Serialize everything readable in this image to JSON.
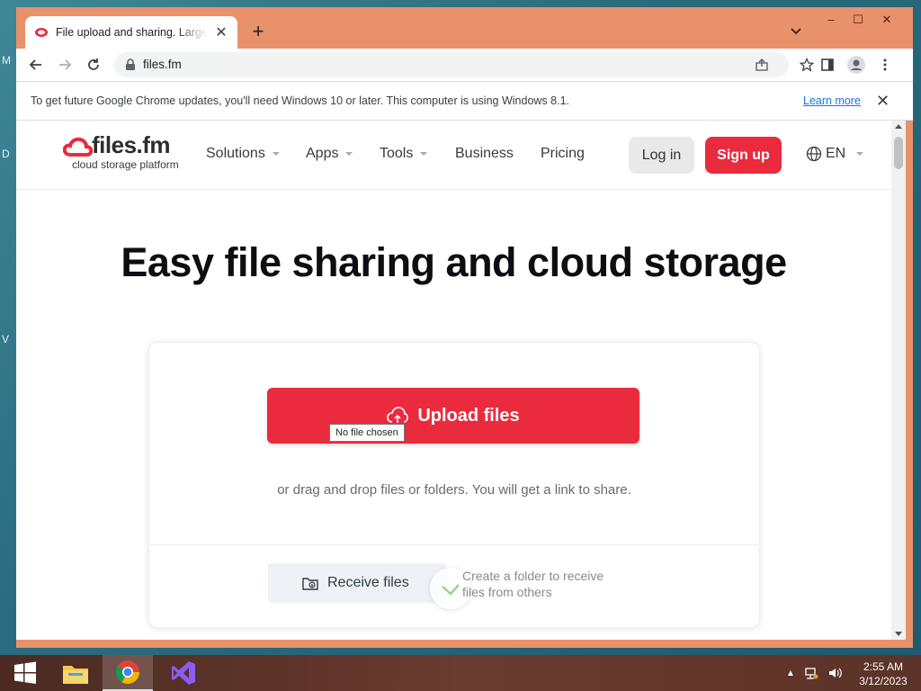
{
  "desktop": {
    "side_letters": [
      "M",
      "D",
      "V"
    ]
  },
  "browser": {
    "tab": {
      "title": "File upload and sharing. Large files",
      "favicon": "filesfm-favicon"
    },
    "new_tab_label": "+",
    "window_controls": {
      "minimize": "–",
      "maximize": "☐",
      "close": "✕"
    },
    "url": "files.fm",
    "infobar": {
      "message": "To get future Google Chrome updates, you'll need Windows 10 or later. This computer is using Windows 8.1.",
      "link": "Learn more",
      "close": "✕"
    }
  },
  "site": {
    "logo": {
      "main": "files.fm",
      "sub": "cloud storage platform"
    },
    "nav": [
      {
        "label": "Solutions",
        "has_dropdown": true
      },
      {
        "label": "Apps",
        "has_dropdown": true
      },
      {
        "label": "Tools",
        "has_dropdown": true
      },
      {
        "label": "Business",
        "has_dropdown": false
      },
      {
        "label": "Pricing",
        "has_dropdown": false
      }
    ],
    "login": "Log in",
    "signup": "Sign up",
    "language": "EN",
    "hero_title": "Easy file sharing and cloud storage",
    "upload": {
      "button": "Upload files",
      "tooltip": "No file chosen",
      "drag_text": "or drag and drop files or folders. You will get a link to share."
    },
    "receive": {
      "button": "Receive files",
      "description": "Create a folder to receive files from others"
    },
    "colors": {
      "brand_red": "#ea2a3d",
      "text_dark": "#0d0d12"
    }
  },
  "taskbar": {
    "apps": [
      "start-icon",
      "file-explorer-icon",
      "chrome-icon",
      "visual-studio-icon"
    ],
    "clock": {
      "time": "2:55 AM",
      "date": "3/12/2023"
    }
  }
}
